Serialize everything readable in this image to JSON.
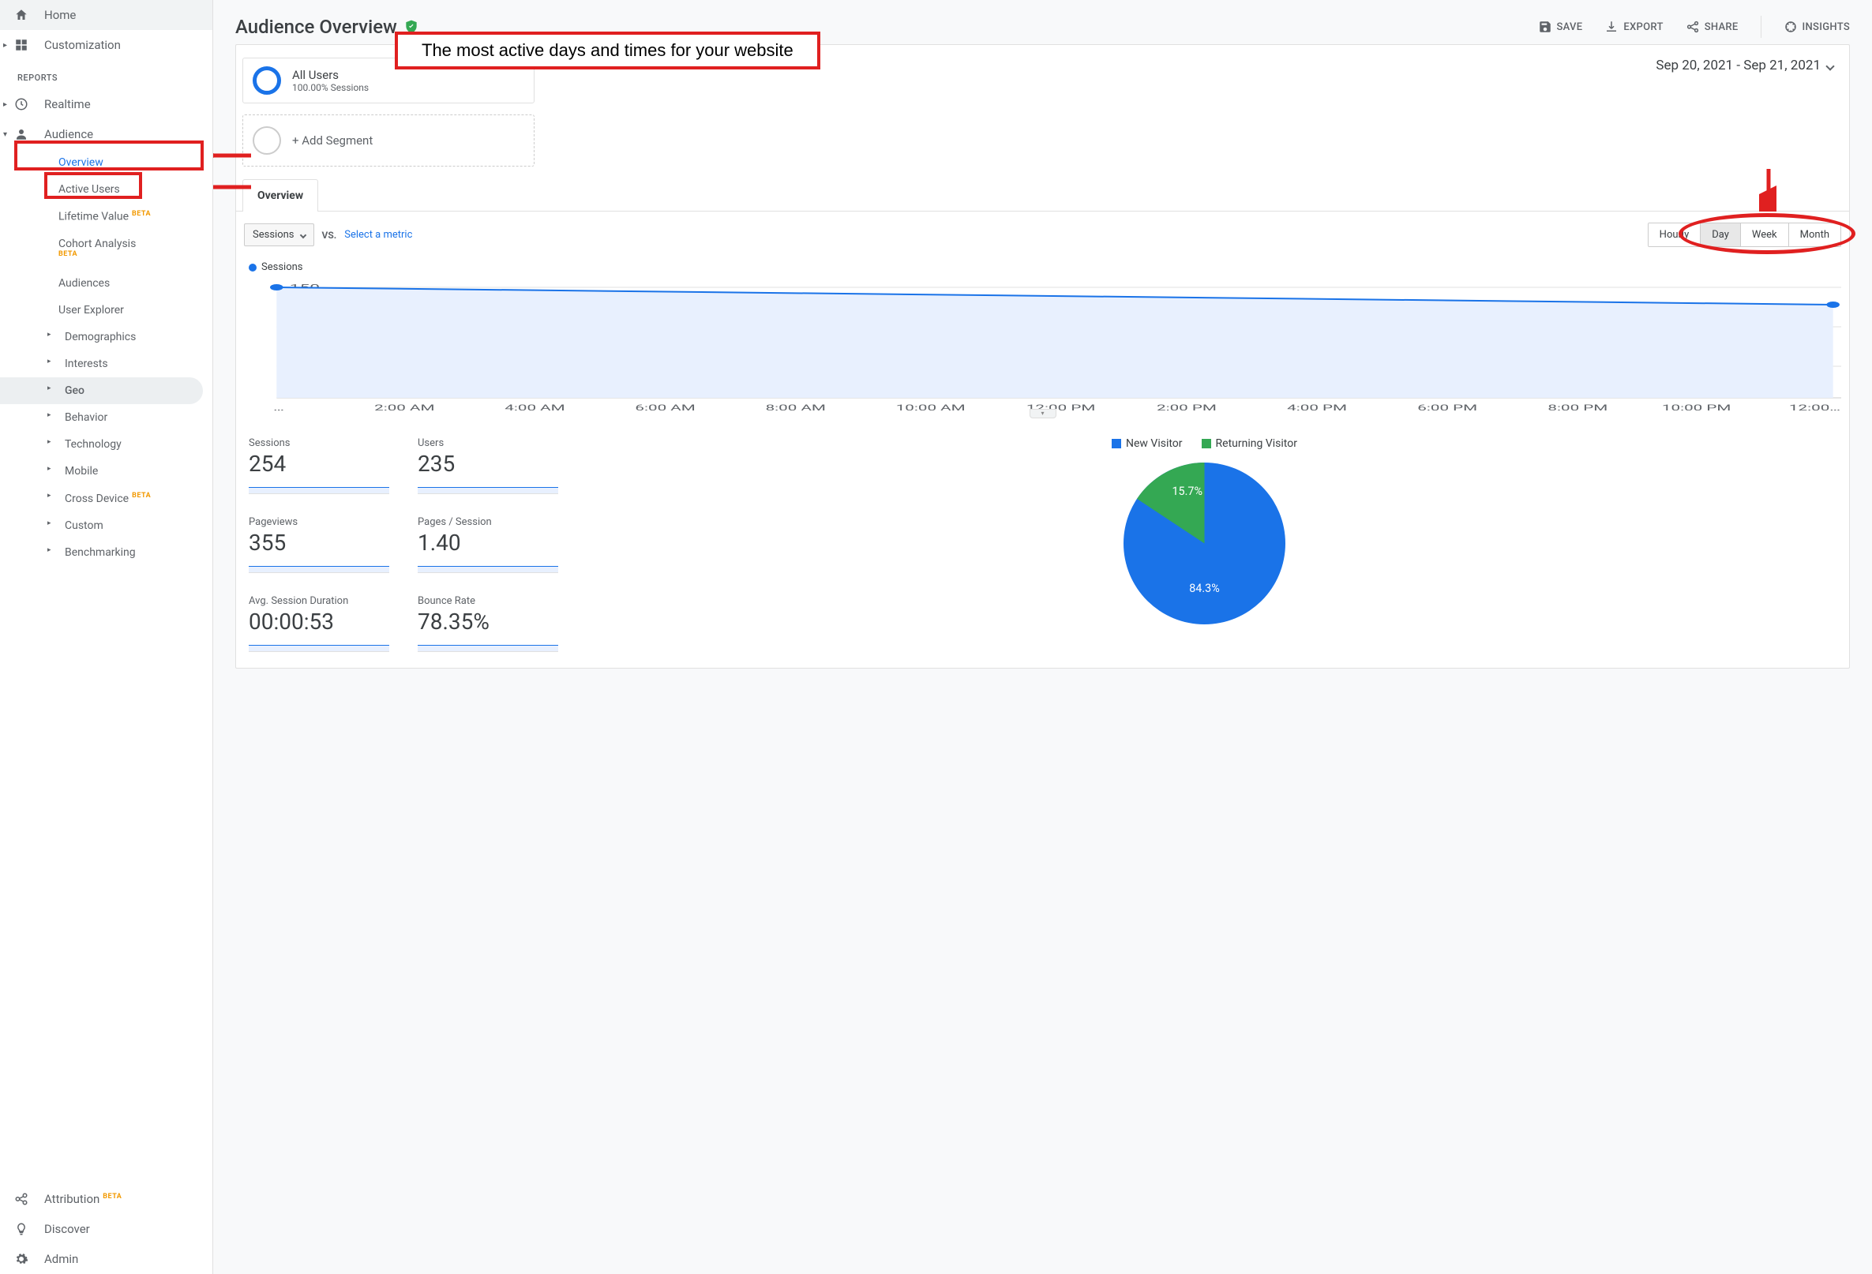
{
  "sidebar": {
    "home": "Home",
    "customization": "Customization",
    "reports_label": "REPORTS",
    "realtime": "Realtime",
    "audience": "Audience",
    "audience_children": {
      "overview": "Overview",
      "active_users": "Active Users",
      "lifetime_value": "Lifetime Value",
      "cohort": "Cohort Analysis",
      "audiences": "Audiences",
      "user_explorer": "User Explorer",
      "demographics": "Demographics",
      "interests": "Interests",
      "geo": "Geo",
      "behavior": "Behavior",
      "technology": "Technology",
      "mobile": "Mobile",
      "cross_device": "Cross Device",
      "custom": "Custom",
      "benchmarking": "Benchmarking"
    },
    "attribution": "Attribution",
    "discover": "Discover",
    "admin": "Admin",
    "beta": "BETA"
  },
  "header": {
    "title": "Audience Overview",
    "save": "SAVE",
    "export": "EXPORT",
    "share": "SHARE",
    "insights": "INSIGHTS"
  },
  "segments": {
    "all_users": "All Users",
    "all_users_sub": "100.00% Sessions",
    "add": "+ Add Segment"
  },
  "date_range": "Sep 20, 2021 - Sep 21, 2021",
  "tab": {
    "overview": "Overview"
  },
  "controls": {
    "metric_select": "Sessions",
    "vs": "VS.",
    "select_metric": "Select a metric",
    "granularity": {
      "hourly": "Hourly",
      "day": "Day",
      "week": "Week",
      "month": "Month"
    }
  },
  "chart": {
    "legend": "Sessions"
  },
  "chart_data": {
    "type": "line",
    "title": "Sessions",
    "xlabel": "",
    "ylabel": "",
    "ylim": [
      0,
      150
    ],
    "y_ticks": [
      50,
      100,
      150
    ],
    "x_ticks": [
      "…",
      "2:00 AM",
      "4:00 AM",
      "6:00 AM",
      "8:00 AM",
      "10:00 AM",
      "12:00 PM",
      "2:00 PM",
      "4:00 PM",
      "6:00 PM",
      "8:00 PM",
      "10:00 PM",
      "12:00…"
    ],
    "series": [
      {
        "name": "Sessions",
        "color": "#1a73e8",
        "points": [
          {
            "x_index": 0,
            "y": 150
          },
          {
            "x_index": 12,
            "y": 126
          }
        ]
      }
    ]
  },
  "metrics": {
    "sessions": {
      "label": "Sessions",
      "value": "254"
    },
    "users": {
      "label": "Users",
      "value": "235"
    },
    "pageviews": {
      "label": "Pageviews",
      "value": "355"
    },
    "pages_per_session": {
      "label": "Pages / Session",
      "value": "1.40"
    },
    "avg_session_duration": {
      "label": "Avg. Session Duration",
      "value": "00:00:53"
    },
    "bounce_rate": {
      "label": "Bounce Rate",
      "value": "78.35%"
    }
  },
  "pie": {
    "legend": {
      "new": "New Visitor",
      "returning": "Returning Visitor"
    },
    "data": [
      {
        "label": "New Visitor",
        "value": 84.3,
        "display": "84.3%",
        "color": "#1a73e8"
      },
      {
        "label": "Returning Visitor",
        "value": 15.7,
        "display": "15.7%",
        "color": "#34a853"
      }
    ]
  },
  "annotations": {
    "callout": "The most active days and times for your website"
  }
}
